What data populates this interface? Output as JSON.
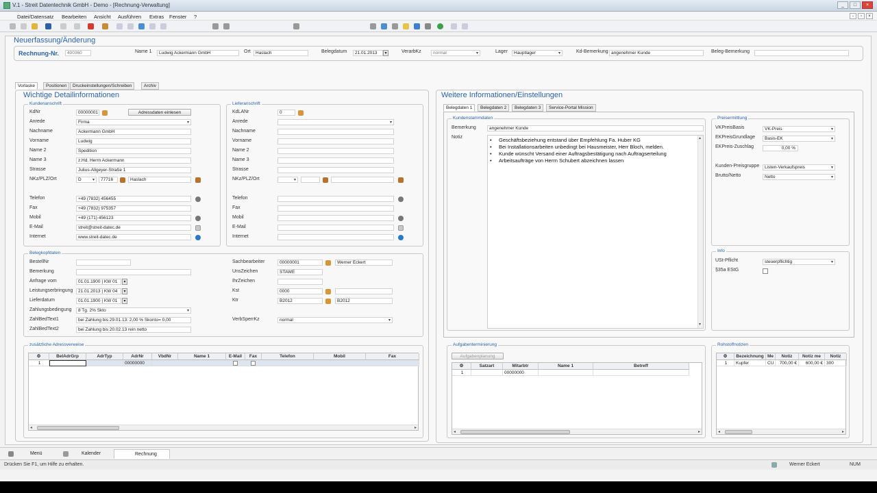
{
  "window": {
    "title": "V.1 - Streit Datentechnik GmbH - Demo - [Rechnung-Verwaltung]"
  },
  "menu": [
    "Datei/Datensatz",
    "Bearbeiten",
    "Ansicht",
    "Ausführen",
    "Extras",
    "Fenster",
    "?"
  ],
  "page_title": "Neuerfassung/Änderung",
  "header": {
    "rechnung_label": "Rechnung-Nr.",
    "rechnung_value": "400360",
    "name1_label": "Name 1",
    "name1_value": "Ludwig Ackermann GmbH",
    "ort_label": "Ort",
    "ort_value": "Haslach",
    "belegdatum_label": "Belegdatum",
    "belegdatum_value": "21.01.2013",
    "verarbkz_label": "VerarbKz",
    "verarbkz_value": "normal",
    "lager_label": "Lager",
    "lager_value": "Hauptlager",
    "kdbem_label": "Kd-Bemerkung",
    "kdbem_value": "angenehmer Kunde",
    "belegbem_label": "Beleg-Bemerkung",
    "belegbem_value": ""
  },
  "tabs": [
    "Vorlaske",
    "Positionen",
    "Druckeinstellungen/Schreiben",
    "Archiv"
  ],
  "left": {
    "title": "Wichtige Detailinformationen",
    "kunden": {
      "legend": "Kundenanschrift",
      "button": "Adressdaten einlesen",
      "labels": [
        "KdNr",
        "Anrede",
        "Nachname",
        "Vorname",
        "Name 2",
        "Name 3",
        "Strasse",
        "NKz/PLZ/Ort",
        "Telefon",
        "Fax",
        "Mobil",
        "E-Mail",
        "Internet"
      ],
      "kdnr": "00000001",
      "anrede": "Firma",
      "nachname": "Ackermann GmbH",
      "vorname": "Ludwig",
      "name2": "Spedition",
      "name3": "z.Hd. Herrn Ackermann",
      "strasse": "Julius-Allgeyer-Straße 1",
      "nkz": "D",
      "plz": "77716",
      "ort": "Haslach",
      "telefon": "+49 (7832) 456455",
      "fax": "+49 (7832) 975357",
      "mobil": "+49 (171) 456123",
      "email": "streit@streit-datec.de",
      "internet": "www.streit-datec.de"
    },
    "liefer": {
      "legend": "Lieferanschrift",
      "labels": [
        "KdLANr",
        "Anrede",
        "Nachname",
        "Vorname",
        "Name 2",
        "Name 3",
        "Strasse",
        "NKz/PLZ/Ort",
        "Telefon",
        "Fax",
        "Mobil",
        "E-Mail",
        "Internet"
      ],
      "kdlanr": "0"
    },
    "beleg": {
      "legend": "Belegkopfdaten",
      "labels": [
        "BestellNr",
        "Bemerkung",
        "Anfrage vom",
        "Leistungserbringung",
        "Lieferdatum",
        "Zahlungsbedingung",
        "ZahlBedText1",
        "ZahlBedText2"
      ],
      "anfrage": "01.01.1900 | KW 01",
      "leistung": "21.01.2013 | KW 04",
      "lieferdatum": "01.01.1900 | KW 01",
      "zahlung": "8 Tg. 2% Skto",
      "zahltext1": "bei Zahlung bis 29.01.13: 2,00 % Skonto= 0,00",
      "zahltext2": "bei Zahlung bis 20.02.13 rein netto",
      "labels2": [
        "Sachbearbeiter",
        "UnsZeichen",
        "IhrZeichen",
        "Kst",
        "Ktr",
        "VerbSperrKz"
      ],
      "sachbearbeiter": "00000001",
      "sachbearbeiter_name": "Werner Eckert",
      "unszeichen": "STAWE",
      "kst": "0000",
      "ktr": "B2012",
      "ktr2": "B2012",
      "verbsperr": "normal"
    },
    "adress": {
      "legend": "zusätzliche Adressverweise",
      "cols": [
        "BelAdrGrp",
        "AdrTyp",
        "AdrNr",
        "VbdNr",
        "Name 1",
        "E-Mail",
        "Fax",
        "Telefon",
        "Mobil",
        "Fax"
      ],
      "row_num": "1",
      "row_adrnr": "00000000"
    }
  },
  "right": {
    "title": "Weitere Informationen/Einstellungen",
    "tabs": [
      "Belegdaten 1",
      "Belegdaten 2",
      "Belegdaten 3",
      "Service-Portal Mission"
    ],
    "stamm": {
      "legend": "Kundenstammdaten",
      "bemerkung_label": "Bemerkung",
      "bemerkung": "angenehmer Kunde",
      "notiz_label": "Notiz",
      "notes": [
        "Geschäftsbeziehung entstand über Empfehlung Fa. Huber KG",
        "Bei Installationsarbeiten unbedingt bei Hausmeister, Herr Bloch, melden.",
        "Kunde wünscht Versand einer Auftragsbestätigung nach Auftragserteilung",
        "Arbeitsaufträge von Herrn Schubert abzeichnen lassen"
      ]
    },
    "preis": {
      "legend": "Preisermittlung",
      "labels": [
        "VKPreisBasis",
        "EKPreisGrundlage",
        "EKPreis-Zuschlag",
        "Kunden-Preisgruppe",
        "Brutto/Netto"
      ],
      "vkbasis": "VK-Preis",
      "ekgrund": "Basis-EK",
      "zuschlag": "0,00 %",
      "preisgruppe": "Listen-Verkaufspreis",
      "brutto": "Netto"
    },
    "info": {
      "legend": "Info",
      "labels": [
        "USt-Pflicht",
        "§35a EStG"
      ],
      "ust": "steuerpflichtig"
    },
    "aufgaben": {
      "legend": "Aufgabenterminierung",
      "button": "Aufgabenplanung",
      "cols": [
        "Satzart",
        "Mitarbtr",
        "Name 1",
        "Betreff"
      ],
      "row_num": "1",
      "row_val": "00000000"
    },
    "rohstoff": {
      "legend": "Rohstoffnotizen",
      "cols": [
        "Bezeichnung",
        "Me",
        "Notiz",
        "Notiz me",
        "Notiz"
      ],
      "row": [
        "1",
        "Kupfer",
        "CU",
        "700,00 €",
        "600,00 €",
        "300"
      ]
    }
  },
  "bottom_tabs": [
    "Menü",
    "Kalender",
    "Rechnung"
  ],
  "status": {
    "help": "Drücken Sie F1, um Hilfe zu erhalten.",
    "user": "Werner Eckert",
    "num": "NUM"
  }
}
